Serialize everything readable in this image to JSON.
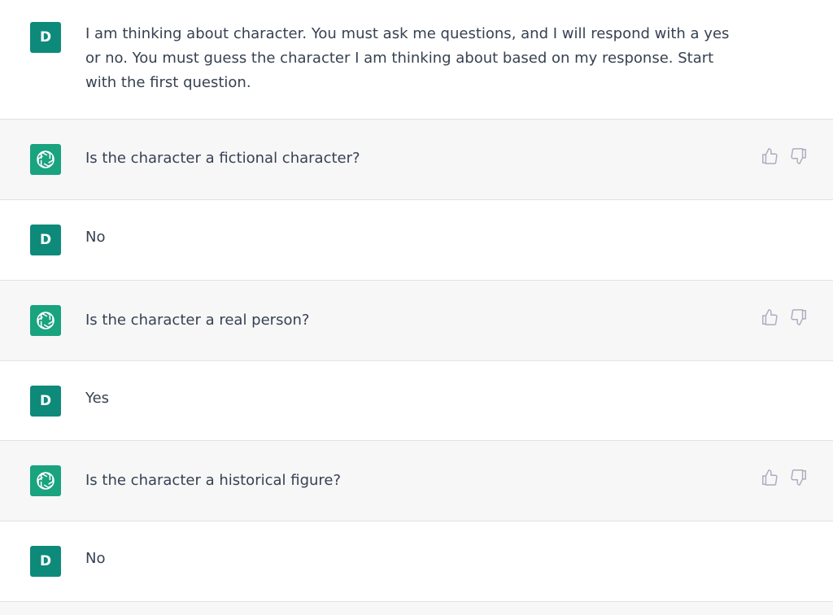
{
  "user": {
    "avatar_initial": "D"
  },
  "messages": [
    {
      "role": "user",
      "text": "I am thinking about character. You must ask me questions, and I will respond with a yes or no. You must guess the character I am thinking about based on my response. Start with the first question."
    },
    {
      "role": "assistant",
      "text": "Is the character a fictional character?",
      "icon": "openai-logo-icon"
    },
    {
      "role": "user",
      "text": "No"
    },
    {
      "role": "assistant",
      "text": "Is the character a real person?",
      "icon": "openai-logo-icon"
    },
    {
      "role": "user",
      "text": "Yes"
    },
    {
      "role": "assistant",
      "text": "Is the character a historical figure?",
      "icon": "openai-logo-icon"
    },
    {
      "role": "user",
      "text": "No"
    }
  ],
  "feedback_icons": [
    "thumbs-up-icon",
    "thumbs-down-icon"
  ],
  "colors": {
    "user_avatar": "#0e8a7a",
    "assistant_avatar": "#19a37f",
    "assistant_row_bg": "#f7f7f8",
    "text": "#374151",
    "icon": "#acacbe"
  }
}
